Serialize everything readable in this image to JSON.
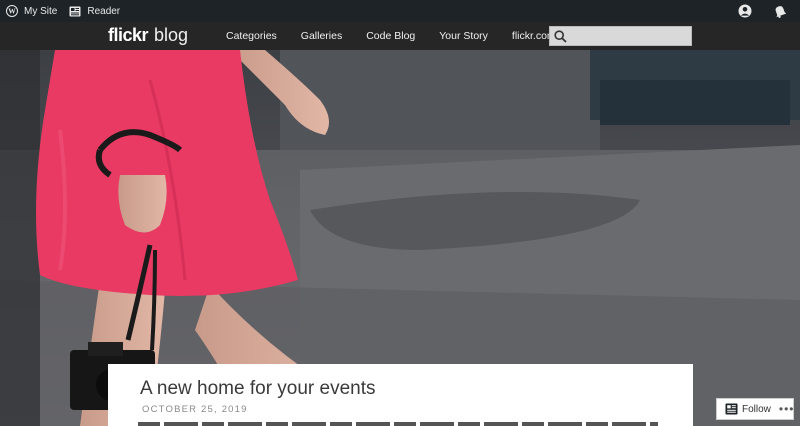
{
  "admin_bar": {
    "my_site_label": "My Site",
    "reader_label": "Reader"
  },
  "header": {
    "logo_brand": "flickr",
    "logo_sub": "blog",
    "nav": [
      "Categories",
      "Galleries",
      "Code Blog",
      "Your Story",
      "flickr.com"
    ],
    "search": {
      "value": "",
      "placeholder": ""
    }
  },
  "post": {
    "title": "A new home for your events",
    "date": "OCTOBER 25, 2019"
  },
  "follow_widget": {
    "follow_label": "Follow",
    "more_label": "•••"
  },
  "colors": {
    "admin_bar_bg": "#1d2327",
    "header_bg": "#262626",
    "dress": "#e83a63",
    "search_bg": "#d9d9d9"
  }
}
